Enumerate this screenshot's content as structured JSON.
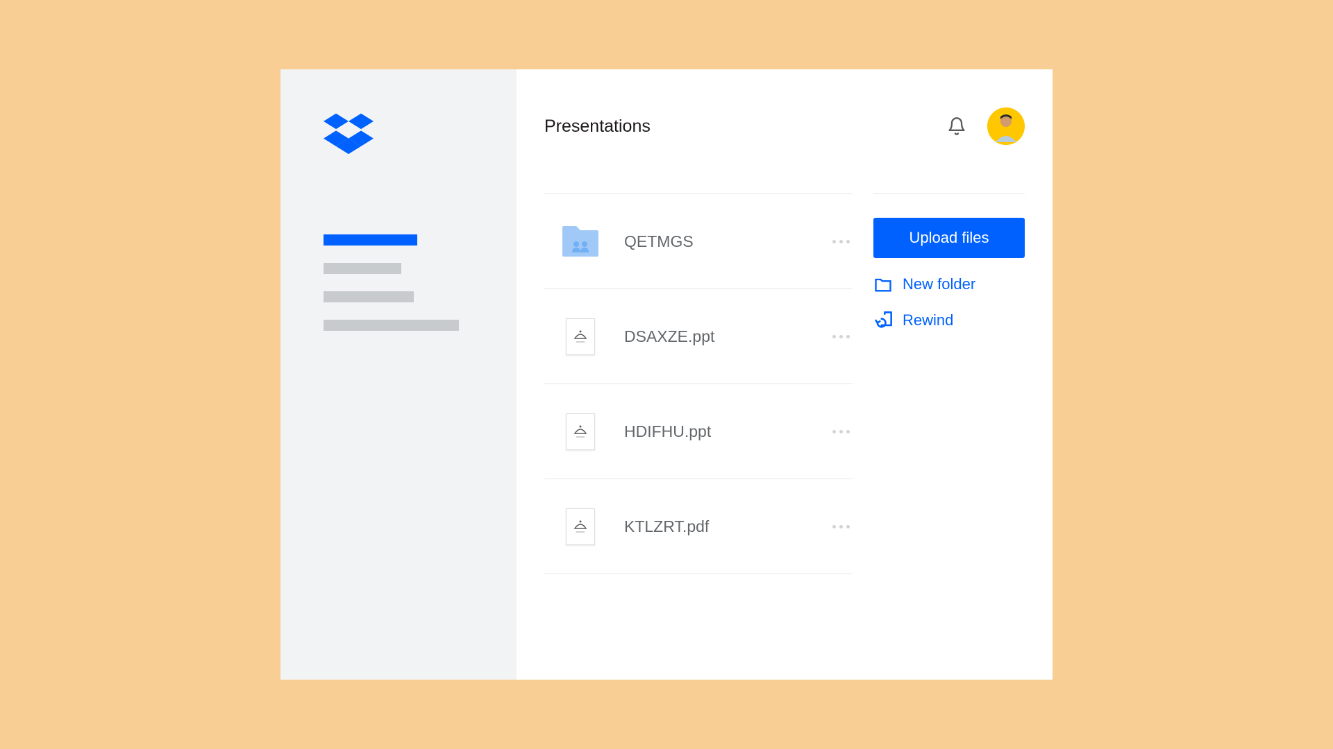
{
  "page_title": "Presentations",
  "files": [
    {
      "name": "QETMGS",
      "type": "folder"
    },
    {
      "name": "DSAXZE.ppt",
      "type": "file"
    },
    {
      "name": "HDIFHU.ppt",
      "type": "file"
    },
    {
      "name": "KTLZRT.pdf",
      "type": "file"
    }
  ],
  "actions": {
    "upload_label": "Upload files",
    "new_folder_label": "New folder",
    "rewind_label": "Rewind"
  },
  "colors": {
    "brand_blue": "#0061fe",
    "peach_bg": "#f8ce94",
    "sidebar_bg": "#f2f3f4",
    "text_muted": "#63676b"
  }
}
